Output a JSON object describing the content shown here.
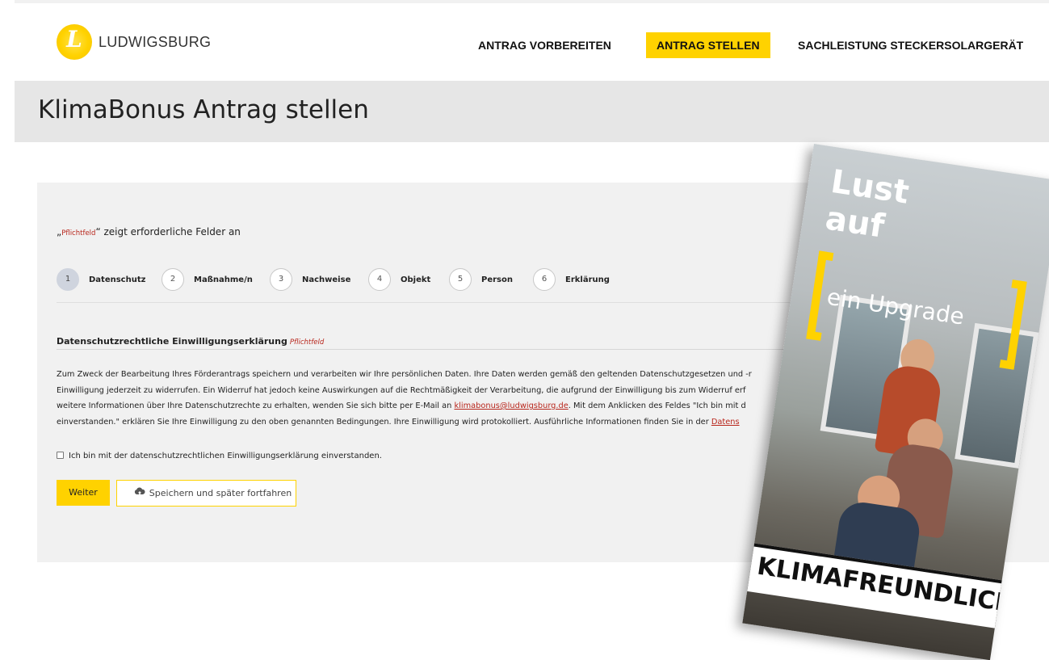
{
  "header": {
    "logo_mark": "L",
    "logo_text": "LUDWIGSBURG",
    "nav": [
      {
        "label": "ANTRAG VORBEREITEN"
      },
      {
        "label": "ANTRAG STELLEN"
      },
      {
        "label": "SACHLEISTUNG STECKERSOLARGERÄT"
      }
    ],
    "accent_color": "#ffd200"
  },
  "page_title": "KlimaBonus Antrag stellen",
  "form": {
    "required_note_prefix": "„",
    "required_note_marker": "Pflichtfeld",
    "required_note_suffix": "“ zeigt erforderliche Felder an",
    "steps": [
      {
        "num": "1",
        "label": "Datenschutz"
      },
      {
        "num": "2",
        "label": "Maßnahme/n"
      },
      {
        "num": "3",
        "label": "Nachweise"
      },
      {
        "num": "4",
        "label": "Objekt"
      },
      {
        "num": "5",
        "label": "Person"
      },
      {
        "num": "6",
        "label": "Erklärung"
      }
    ],
    "section_title": "Datenschutzrechtliche Einwilligungserklärung",
    "section_required": "Pflichtfeld",
    "body_line1": "Zum Zweck der Bearbeitung Ihres Förderantrags speichern und verarbeiten wir Ihre persönlichen Daten. Ihre Daten werden gemäß den geltenden Datenschutzgesetzen und -r",
    "body_line2": "Einwilligung jederzeit zu widerrufen. Ein Widerruf hat jedoch keine Auswirkungen auf die Rechtmäßigkeit der Verarbeitung, die aufgrund der Einwilligung bis zum Widerruf erf",
    "body_line3_a": "weitere Informationen über Ihre Datenschutzrechte zu erhalten, wenden Sie sich bitte per E-Mail an ",
    "body_email": "klimabonus@ludwigsburg.de",
    "body_line3_b": ". Mit dem Anklicken des Feldes \"Ich bin mit d",
    "body_line4_a": "einverstanden.\" erklären Sie Ihre Einwilligung zu den oben genannten Bedingungen. Ihre Einwilligung wird protokolliert. Ausführliche Informationen finden Sie in der ",
    "body_link_end": "Datens",
    "consent_label": "Ich bin mit der datenschutzrechtlichen Einwilligungserklärung einverstanden.",
    "next_button": "Weiter",
    "save_button": "Speichern und später fortfahren"
  },
  "poster": {
    "title_line1": "Lust",
    "title_line2": "auf",
    "subtitle": "ein Upgrade",
    "banner": "KLIMAFREUNDLICH"
  }
}
